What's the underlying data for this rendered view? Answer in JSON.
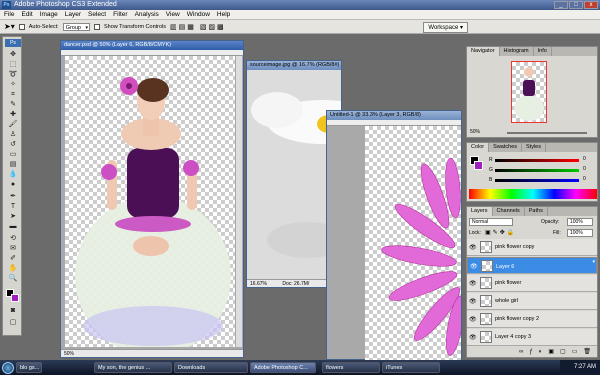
{
  "app": {
    "title": "Adobe Photoshop CS3 Extended"
  },
  "menu": [
    "File",
    "Edit",
    "Image",
    "Layer",
    "Select",
    "Filter",
    "Analysis",
    "View",
    "Window",
    "Help"
  ],
  "options": {
    "auto_select_label": "Auto-Select:",
    "auto_select_value": "Group",
    "transform_label": "Show Transform Controls",
    "workspace_label": "Workspace ▾"
  },
  "documents": {
    "dancer": {
      "title": "dancer.psd @ 50% (Layer 6, RGB/8/CMYK)",
      "zoom": "50%"
    },
    "source": {
      "title": "sourceimage.jpg @ 16.7% (RGB/8#)",
      "zoom": "16.67%",
      "doc_info": "Doc: 26.7M/"
    },
    "untitled": {
      "title": "Untitled-1 @ 33.3% (Layer 3, RGB/8)"
    }
  },
  "navigator": {
    "tabs": [
      "Navigator",
      "Histogram",
      "Info"
    ],
    "zoom": "50%"
  },
  "color": {
    "tabs": [
      "Color",
      "Swatches",
      "Styles"
    ],
    "channels": [
      {
        "label": "R",
        "value": "0"
      },
      {
        "label": "G",
        "value": "0"
      },
      {
        "label": "B",
        "value": "0"
      }
    ]
  },
  "layers": {
    "tabs": [
      "Layers",
      "Channels",
      "Paths"
    ],
    "blend_mode": "Normal",
    "opacity_label": "Opacity:",
    "opacity_value": "100%",
    "lock_label": "Lock:",
    "fill_label": "Fill:",
    "fill_value": "100%",
    "items": [
      {
        "name": "pink flower copy",
        "selected": false
      },
      {
        "name": "Layer 6",
        "selected": true
      },
      {
        "name": "pink flower",
        "selected": false
      },
      {
        "name": "whole girl",
        "selected": false
      },
      {
        "name": "pink flower copy 2",
        "selected": false
      },
      {
        "name": "Layer 4 copy 3",
        "selected": false
      }
    ]
  },
  "taskbar": {
    "items": [
      "blo gs...",
      "My son, the genius ...",
      "Downloads",
      "Adobe Photoshop C...",
      "flowers",
      "iTunes"
    ],
    "time": "7:27 AM"
  },
  "colors": {
    "accent": "#3c8ce6",
    "titlebar": "#3e5a8c",
    "foreground": "#000000",
    "background": "#a020c0"
  }
}
